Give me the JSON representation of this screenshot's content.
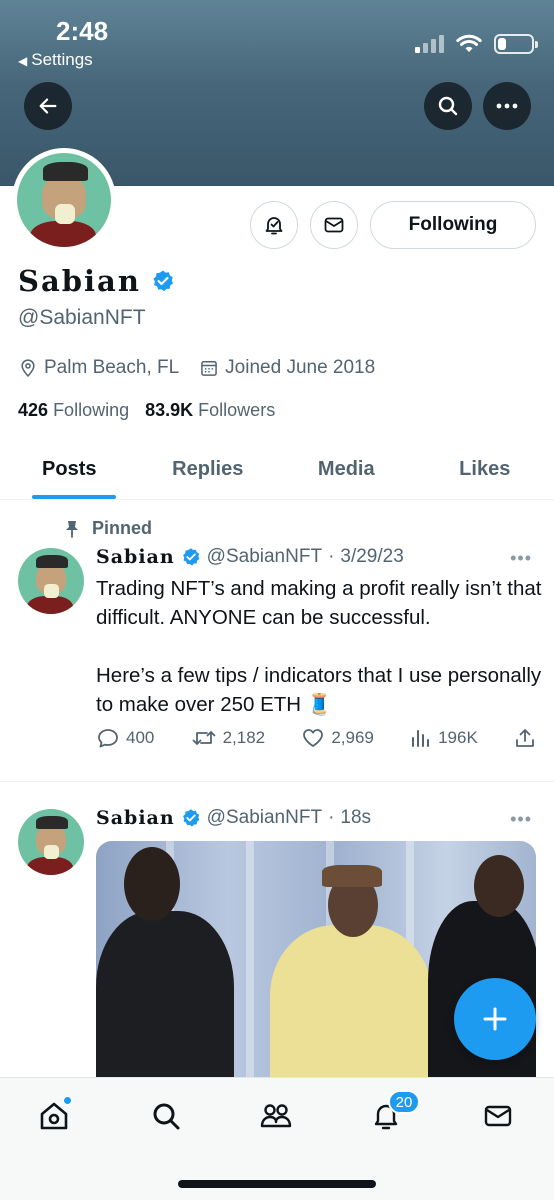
{
  "status_bar": {
    "time": "2:48",
    "back_label": "Settings",
    "battery_level": 0.25,
    "signal_bars_on": 1
  },
  "header": {
    "back_icon": "arrow-left-icon",
    "search_icon": "search-icon",
    "more_icon": "more-icon"
  },
  "profile": {
    "display_name": "Sabian",
    "handle": "@SabianNFT",
    "location": "Palm Beach, FL",
    "joined": "Joined June 2018",
    "following_count": "426",
    "following_label": "Following",
    "followers_count": "83.9K",
    "followers_label": "Followers",
    "follow_button_label": "Following",
    "verified_color": "#1d9bf0"
  },
  "tabs": [
    {
      "label": "Posts",
      "active": true
    },
    {
      "label": "Replies",
      "active": false
    },
    {
      "label": "Media",
      "active": false
    },
    {
      "label": "Likes",
      "active": false
    }
  ],
  "tweets": [
    {
      "pinned_label": "Pinned",
      "name": "Sabian",
      "handle": "@SabianNFT",
      "separator": "·",
      "time": "3/29/23",
      "text_lines": [
        "Trading NFT’s and making a profit really isn’t that difficult. ANYONE can be successful.",
        "Here’s a few tips / indicators that I use personally to make over 250 ETH 🧵"
      ],
      "replies": "400",
      "retweets": "2,182",
      "likes": "2,969",
      "views": "196K"
    },
    {
      "name": "Sabian",
      "handle": "@SabianNFT",
      "separator": "·",
      "time": "18s"
    }
  ],
  "bottom_nav": {
    "notifications_count": "20"
  },
  "colors": {
    "accent": "#1d9bf0",
    "text": "#0f1419",
    "muted": "#536471"
  }
}
